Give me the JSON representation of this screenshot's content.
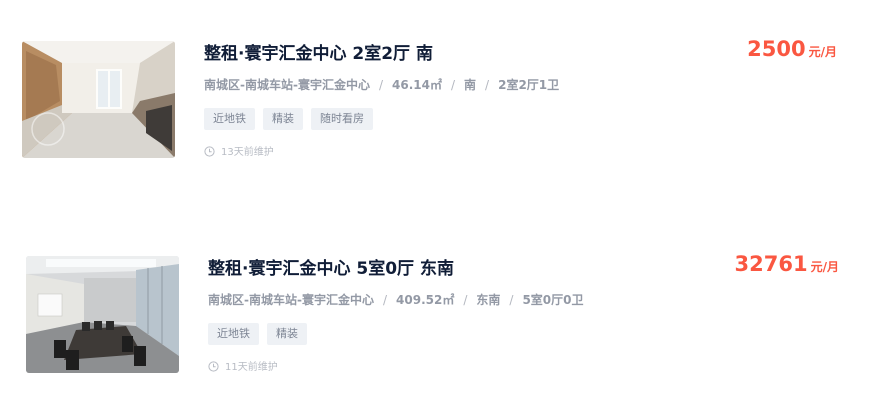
{
  "listings": [
    {
      "title": "整租·寰宇汇金中心 2室2厅 南",
      "location": "南城区-南城车站-寰宇汇金中心",
      "area": "46.14㎡",
      "orientation": "南",
      "layout": "2室2厅1卫",
      "tags": [
        "近地铁",
        "精装",
        "随时看房"
      ],
      "maintained": "13天前维护",
      "price": "2500",
      "price_unit": "元/月",
      "image": "apartment-interior-photo"
    },
    {
      "title": "整租·寰宇汇金中心 5室0厅 东南",
      "location": "南城区-南城车站-寰宇汇金中心",
      "area": "409.52㎡",
      "orientation": "东南",
      "layout": "5室0厅0卫",
      "tags": [
        "近地铁",
        "精装"
      ],
      "maintained": "11天前维护",
      "price": "32761",
      "price_unit": "元/月",
      "image": "conference-room-photo"
    }
  ],
  "separator": "/",
  "colors": {
    "title": "#101d37",
    "meta": "#9399a5",
    "tag_bg": "#eef1f5",
    "tag_text": "#7d8594",
    "price": "#fa5741",
    "muted": "#b8bcc4"
  }
}
